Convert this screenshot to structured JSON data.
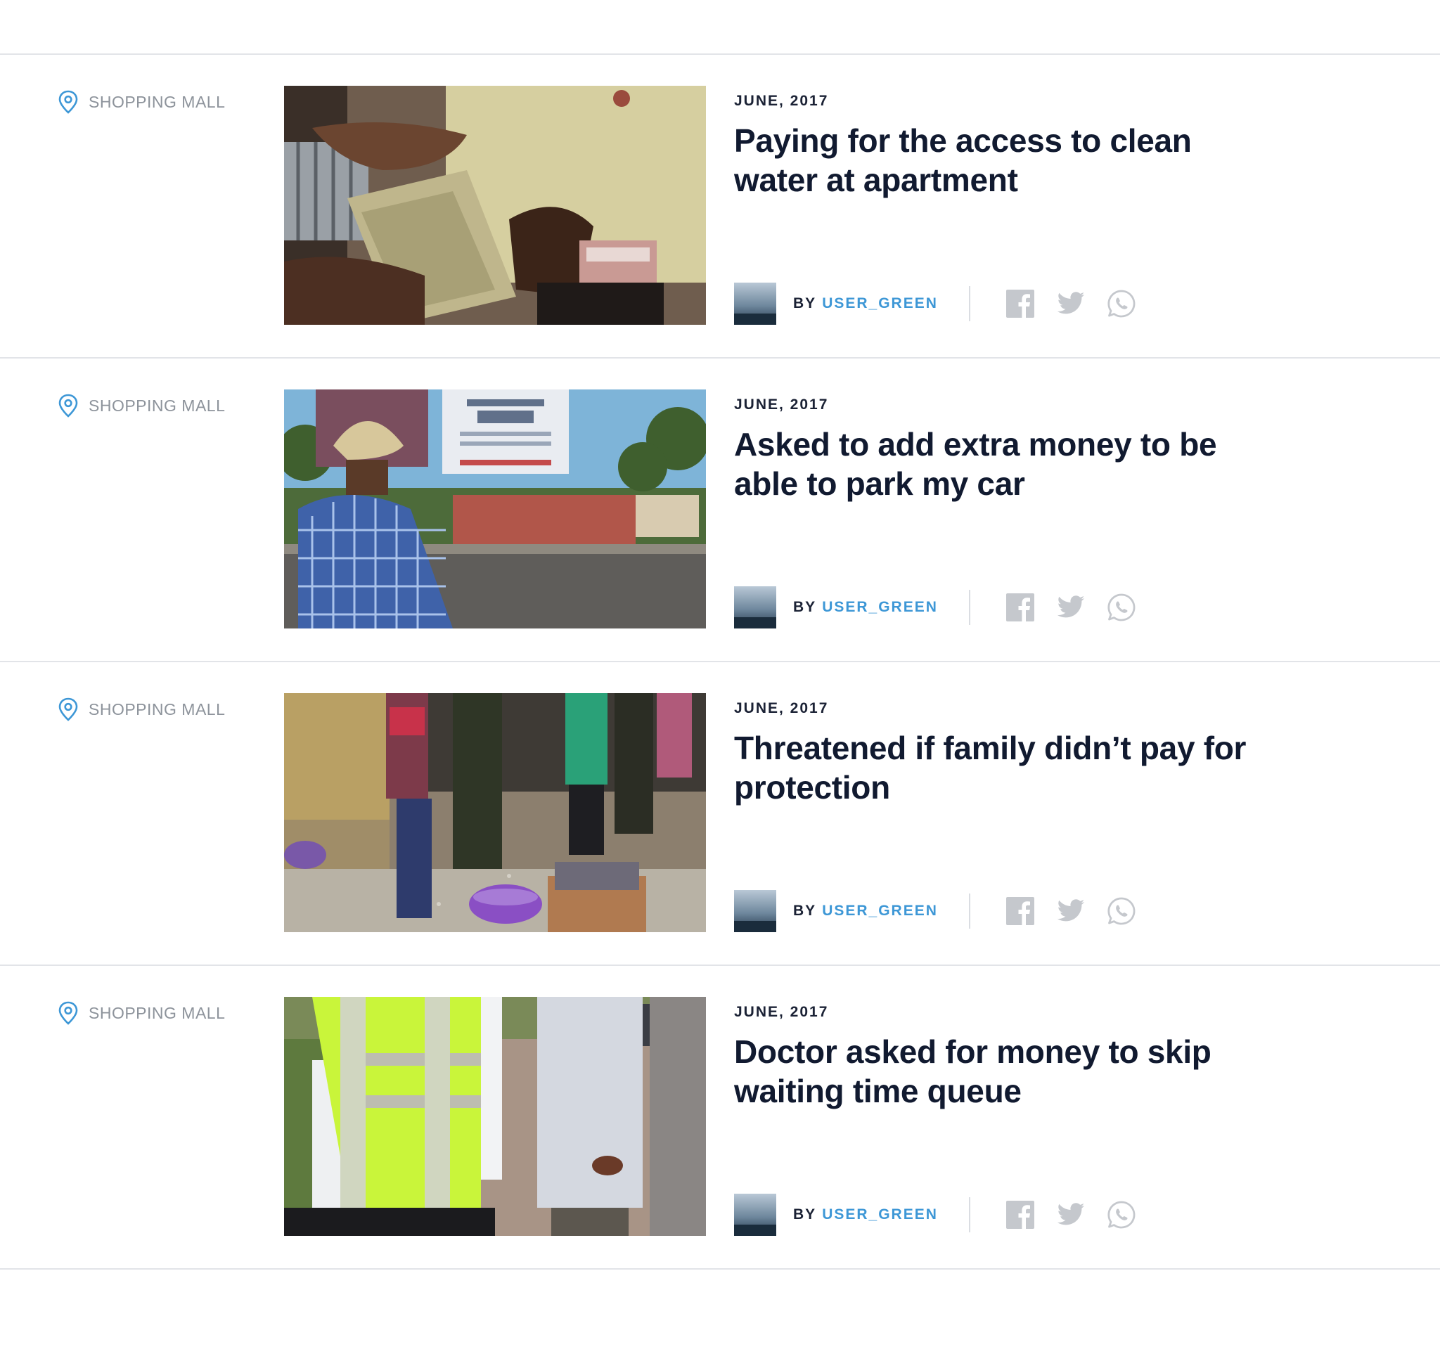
{
  "stories": [
    {
      "location": "SHOPPING MALL",
      "date": "JUNE, 2017",
      "title": "Paying for the access to clean water at apartment",
      "by": "BY",
      "author": "USER_GREEN"
    },
    {
      "location": "SHOPPING MALL",
      "date": "JUNE, 2017",
      "title": "Asked to add extra money to be able to park my car",
      "by": "BY",
      "author": "USER_GREEN"
    },
    {
      "location": "SHOPPING MALL",
      "date": "JUNE, 2017",
      "title": "Threatened if family didn’t pay for protection",
      "by": "BY",
      "author": "USER_GREEN"
    },
    {
      "location": "SHOPPING MALL",
      "date": "JUNE, 2017",
      "title": "Doctor asked for money to skip waiting time queue",
      "by": "BY",
      "author": "USER_GREEN"
    }
  ],
  "share_icons": [
    "facebook-icon",
    "twitter-icon",
    "whatsapp-icon"
  ],
  "colors": {
    "accent": "#3d97d6",
    "text_dark": "#111a30",
    "muted": "#8d939b",
    "share_icon": "#c5c8cd",
    "divider": "#e2e4e8"
  }
}
